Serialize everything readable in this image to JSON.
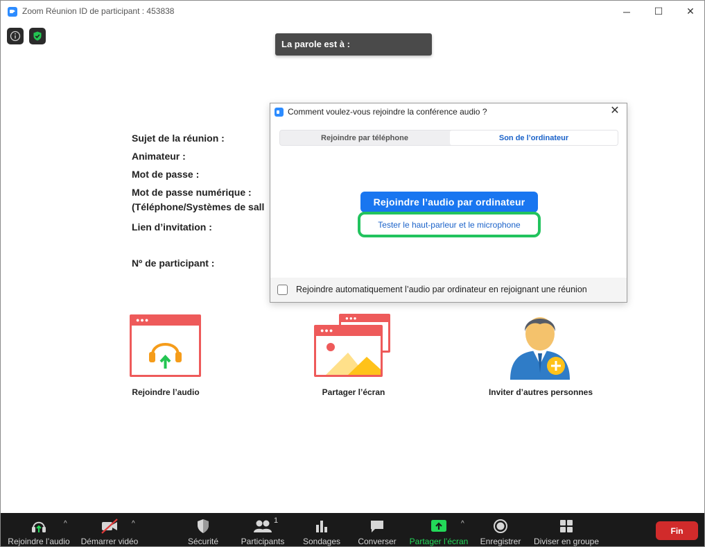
{
  "window": {
    "title": "Zoom Réunion ID de participant : 453838",
    "minimize_glyph": "─",
    "maximize_glyph": "☐",
    "close_glyph": "✕"
  },
  "speaker": {
    "label": "La parole est à :"
  },
  "meeting_info": {
    "topic": "Sujet de la réunion :",
    "host": "Animateur :",
    "password": "Mot de passe :",
    "numeric_password_line1": "Mot de passe numérique :",
    "numeric_password_line2": "(Téléphone/Systèmes de sall",
    "invite_link": "Lien d’invitation :",
    "participant_id": "Nº de participant :"
  },
  "tiles": {
    "join_audio": "Rejoindre l’audio",
    "share_screen": "Partager l’écran",
    "invite": "Inviter d’autres personnes"
  },
  "dialog": {
    "title": "Comment voulez-vous rejoindre la conférence audio ?",
    "close_glyph": "✕",
    "tabs": [
      {
        "label": "Rejoindre par téléphone",
        "selected": false
      },
      {
        "label": "Son de l’ordinateur",
        "selected": true
      }
    ],
    "join_button": "Rejoindre l’audio par ordinateur",
    "test_link": "Tester le haut-parleur et le microphone",
    "auto_join_label": "Rejoindre automatiquement l’audio par ordinateur en rejoignant une réunion",
    "auto_join_checked": false
  },
  "toolbar": {
    "items": [
      {
        "label": "Rejoindre l’audio",
        "icon": "headphones-icon"
      },
      {
        "label": "Démarrer vidéo",
        "icon": "video-off-icon"
      },
      {
        "label": "Sécurité",
        "icon": "shield-icon"
      },
      {
        "label": "Participants",
        "icon": "participants-icon",
        "count": "1"
      },
      {
        "label": "Sondages",
        "icon": "poll-icon"
      },
      {
        "label": "Converser",
        "icon": "chat-icon"
      },
      {
        "label": "Partager l’écran",
        "icon": "share-screen-icon"
      },
      {
        "label": "Enregistrer",
        "icon": "record-icon"
      },
      {
        "label": "Diviser en groupe",
        "icon": "breakout-icon"
      }
    ],
    "caret_glyph": "^",
    "end_label": "Fin"
  },
  "colors": {
    "accent_blue": "#1976f0",
    "link_blue": "#1a62c9",
    "highlight_green": "#22c35e",
    "share_green": "#23d959",
    "end_red": "#d12b2b",
    "tile_red": "#ee5a5a"
  }
}
